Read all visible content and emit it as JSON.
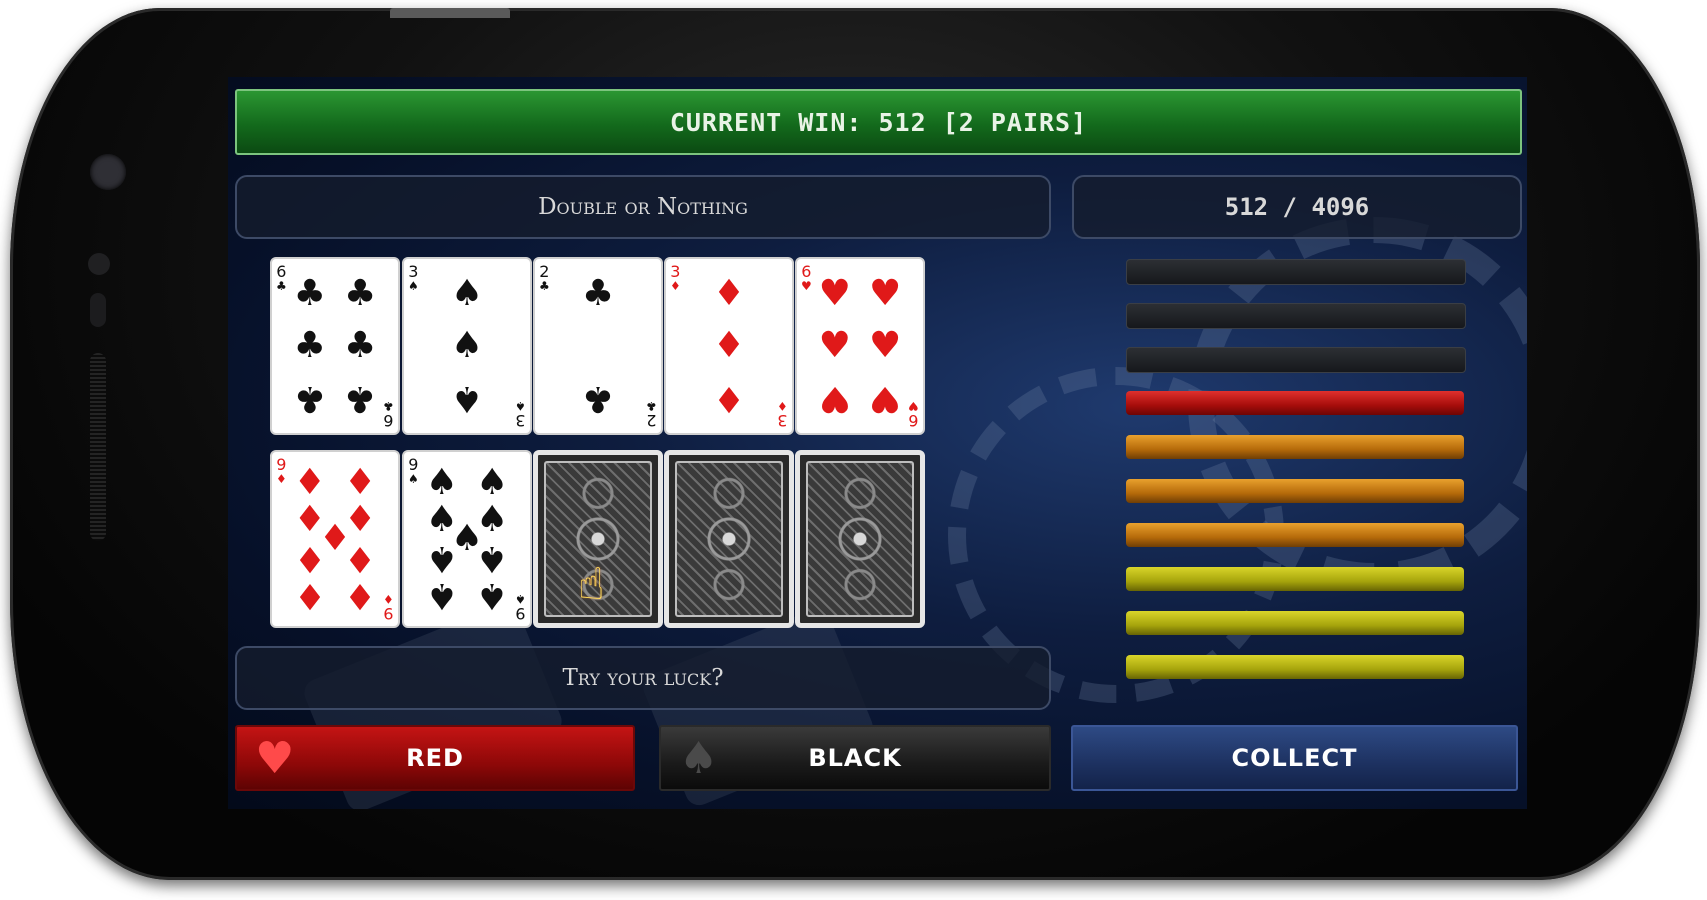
{
  "game": {
    "current_win": "CURRENT WIN: 512 [2 PAIRS]",
    "title": "Double or Nothing",
    "score": "512 / 4096",
    "prompt": "Try your luck?"
  },
  "hand": [
    {
      "rank": "6",
      "suit": "♣",
      "color": "black"
    },
    {
      "rank": "3",
      "suit": "♠",
      "color": "black"
    },
    {
      "rank": "2",
      "suit": "♣",
      "color": "black"
    },
    {
      "rank": "3",
      "suit": "♦",
      "color": "red"
    },
    {
      "rank": "6",
      "suit": "♥",
      "color": "red"
    }
  ],
  "gamble_row": [
    {
      "rank": "9",
      "suit": "♦",
      "color": "red",
      "face_up": true
    },
    {
      "rank": "9",
      "suit": "♠",
      "color": "black",
      "face_up": true
    },
    {
      "face_up": false
    },
    {
      "face_up": false
    },
    {
      "face_up": false
    }
  ],
  "ladder": {
    "steps": 10,
    "colors": [
      "off",
      "off",
      "off",
      "red",
      "orange",
      "orange",
      "orange",
      "yellow",
      "yellow",
      "yellow"
    ],
    "lit_count": 7
  },
  "buttons": {
    "red": "RED",
    "black": "BLACK",
    "collect": "COLLECT"
  },
  "icons": {
    "red_button": "heart-icon",
    "black_button": "spade-icon",
    "pointer": "hand-pointer-icon"
  },
  "colors": {
    "win_bar": "#136a1c",
    "red_button": "#8e0808",
    "collect_button": "#1d3160",
    "card_red": "#e01919"
  }
}
